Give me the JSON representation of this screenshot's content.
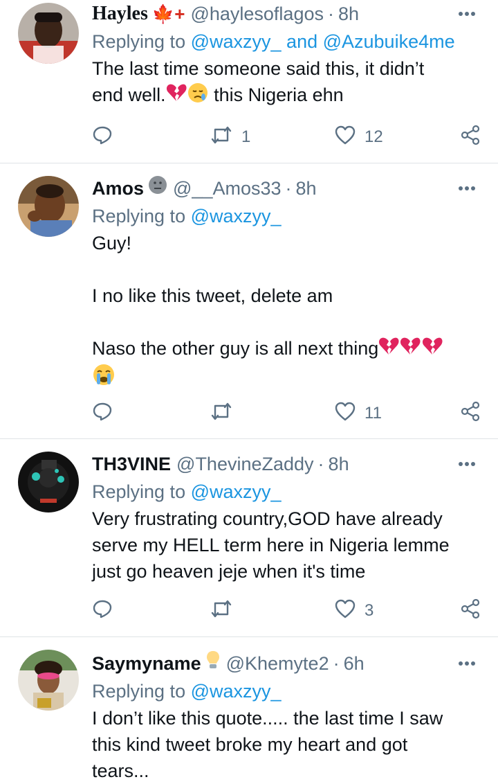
{
  "tweets": [
    {
      "name": "Hayles",
      "name_suffix": "🍁+",
      "handle": "@haylesoflagos",
      "time": "8h",
      "replying_prefix": "Replying to ",
      "mentions": [
        "@waxzyy_",
        "@Azubuike4me"
      ],
      "mention_joiner": " and ",
      "body_line1": "The last time someone said this, it didn’t",
      "body_line2_a": "end well.",
      "body_line2_b": " this Nigeria ehn",
      "retweets": "1",
      "likes": "12"
    },
    {
      "name": "Amos",
      "handle": "@__Amos33",
      "time": "8h",
      "replying_prefix": "Replying to ",
      "mentions": [
        "@waxzyy_"
      ],
      "body_p1": "Guy!",
      "body_p2": "I no like this tweet, delete am",
      "body_p3": "Naso the other guy is all next thing",
      "retweets": "",
      "likes": "11"
    },
    {
      "name": "TH3VINE",
      "handle": "@ThevineZaddy",
      "time": "8h",
      "replying_prefix": "Replying to ",
      "mentions": [
        "@waxzyy_"
      ],
      "body_line1": "Very frustrating country,GOD have already",
      "body_line2": "serve my HELL term here in Nigeria lemme",
      "body_line3": "just go heaven jeje when it's time",
      "retweets": "",
      "likes": "3"
    },
    {
      "name": "Saymyname",
      "handle": "@Khemyte2",
      "time": "6h",
      "replying_prefix": "Replying to ",
      "mentions": [
        "@waxzyy_"
      ],
      "body_line1": "I don’t like this quote..... the last time I saw",
      "body_line2": "this kind tweet broke my heart and got",
      "body_line3": "tears..."
    }
  ],
  "separator": "·",
  "colors": {
    "secondary_text": "#5b7083",
    "link": "#1b95e0",
    "divider": "#dfe3e6",
    "broken_heart": "#e0245e"
  },
  "icons": [
    "reply-icon",
    "retweet-icon",
    "like-icon",
    "share-icon",
    "more-icon"
  ]
}
